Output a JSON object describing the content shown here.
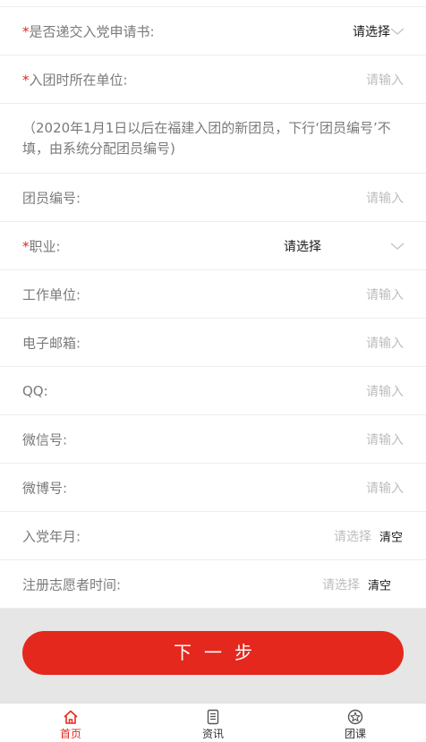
{
  "form": {
    "party_application": {
      "required_mark": "*",
      "label": "是否递交入党申请书:",
      "value": "请选择"
    },
    "join_unit": {
      "required_mark": "*",
      "label": "入团时所在单位:",
      "placeholder": "请输入"
    },
    "notice": "（2020年1月1日以后在福建入团的新团员，下行‘团员编号’不填，由系统分配团员编号)",
    "member_number": {
      "label": "团员编号:",
      "placeholder": "请输入"
    },
    "occupation": {
      "required_mark": "*",
      "label": "职业:",
      "value": "请选择"
    },
    "work_unit": {
      "label": "工作单位:",
      "placeholder": "请输入"
    },
    "email": {
      "label": "电子邮箱:",
      "placeholder": "请输入"
    },
    "qq": {
      "label": "QQ:",
      "placeholder": "请输入"
    },
    "wechat": {
      "label": "微信号:",
      "placeholder": "请输入"
    },
    "weibo": {
      "label": "微博号:",
      "placeholder": "请输入"
    },
    "party_date": {
      "label": "入党年月:",
      "placeholder": "请选择",
      "clear_label": "清空"
    },
    "volunteer_date": {
      "label": "注册志愿者时间:",
      "placeholder": "请选择",
      "clear_label": "清空"
    }
  },
  "next_button": {
    "label": "下一步"
  },
  "tabbar": {
    "items": [
      {
        "label": "首页",
        "icon": "home-icon",
        "active": true
      },
      {
        "label": "资讯",
        "icon": "news-icon",
        "active": false
      },
      {
        "label": "团课",
        "icon": "badge-icon",
        "active": false
      }
    ]
  },
  "colors": {
    "accent": "#e4281e",
    "label": "#7a7a7a",
    "placeholder": "#bdbdbd",
    "footer_bg": "#e6e6e6"
  }
}
